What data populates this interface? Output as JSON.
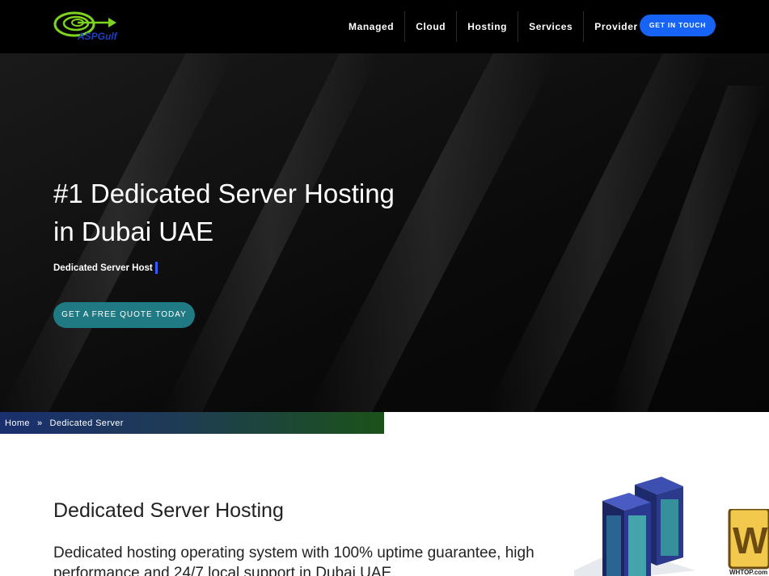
{
  "brand": {
    "logo_text": "ASPGulf"
  },
  "nav": {
    "items": [
      "Managed",
      "Cloud",
      "Hosting",
      "Services",
      "Provider"
    ],
    "cta": "GET IN TOUCH"
  },
  "hero": {
    "title_line1": "#1 Dedicated Server Hosting",
    "title_line2": "in Dubai UAE",
    "subtitle": "Dedicated Server Host",
    "button": "GET A FREE QUOTE TODAY"
  },
  "breadcrumb": {
    "home": "Home",
    "separator": "»",
    "current": "Dedicated Server"
  },
  "content": {
    "title": "Dedicated Server Hosting",
    "description": "Dedicated hosting operating system with 100% uptime guarantee, high performance and 24/7 local support in Dubai UAE."
  },
  "watermark": {
    "text": "WHTOP.com"
  },
  "colors": {
    "header_bg": "#000000",
    "cta_blue": "#1763f5",
    "hero_button": "#1f7a84",
    "logo_green": "#7ed321",
    "logo_blue": "#1e3fbf"
  }
}
